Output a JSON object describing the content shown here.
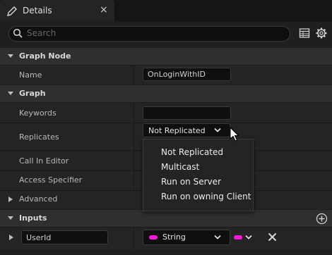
{
  "tab": {
    "title": "Details",
    "close": "×"
  },
  "search": {
    "placeholder": "Search"
  },
  "sections": {
    "graph_node": "Graph Node",
    "graph": "Graph",
    "advanced": "Advanced",
    "inputs": "Inputs"
  },
  "properties": {
    "name": {
      "label": "Name",
      "value": "OnLoginWithID"
    },
    "keywords": {
      "label": "Keywords",
      "value": ""
    },
    "replicates": {
      "label": "Replicates",
      "value": "Not Replicated"
    },
    "call_in_editor": {
      "label": "Call In Editor"
    },
    "access_specifier": {
      "label": "Access Specifier"
    }
  },
  "replicates_menu": {
    "options": [
      "Not Replicated",
      "Multicast",
      "Run on Server",
      "Run on owning Client"
    ]
  },
  "input_param": {
    "name": "UserId",
    "type": "String",
    "type_color": "#ff17d6"
  },
  "colors": {
    "panel": "#1f1f1f",
    "category": "#2f2f2f",
    "row": "#242424",
    "accent_string": "#ff17d6"
  }
}
